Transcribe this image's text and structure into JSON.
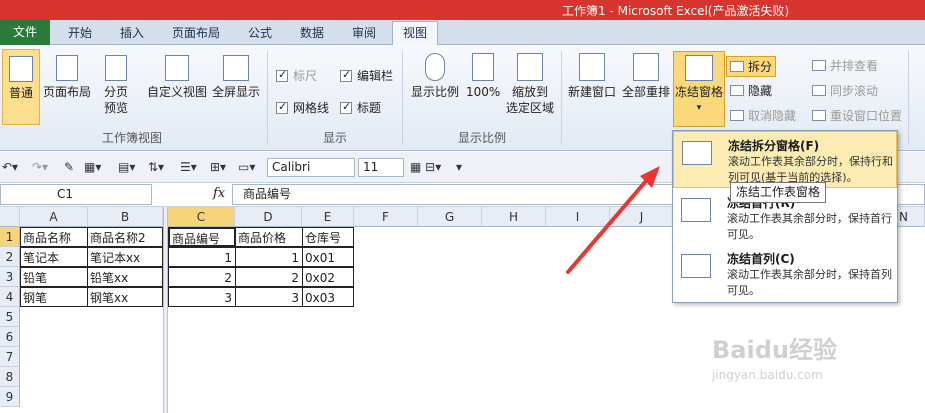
{
  "window": {
    "title": "工作簿1 - Microsoft Excel(产品激活失败)"
  },
  "tabs": [
    "文件",
    "开始",
    "插入",
    "页面布局",
    "公式",
    "数据",
    "审阅",
    "视图"
  ],
  "ribbon": {
    "workbook_views": {
      "label": "工作簿视图",
      "buttons": [
        "普通",
        "页面布局",
        "分页",
        "预览",
        "自定义视图",
        "全屏显示"
      ]
    },
    "show": {
      "label": "显示",
      "checks": [
        {
          "label": "标尺",
          "checked": true,
          "disabled": true
        },
        {
          "label": "编辑栏",
          "checked": true
        },
        {
          "label": "网格线",
          "checked": true
        },
        {
          "label": "标题",
          "checked": true
        }
      ]
    },
    "zoom": {
      "label": "显示比例",
      "buttons": [
        "显示比例",
        "100%",
        "缩放到",
        "选定区域"
      ]
    },
    "window": {
      "buttons": [
        "新建窗口",
        "全部重排",
        "冻结窗格"
      ],
      "small": [
        "拆分",
        "隐藏",
        "取消隐藏",
        "并排查看",
        "同步滚动",
        "重设窗口位置"
      ]
    }
  },
  "toolbar": {
    "font": "Calibri",
    "size": "11"
  },
  "formula_bar": {
    "name_box": "C1",
    "fx": "fx",
    "content": "商品编号"
  },
  "grid": {
    "columns": [
      "A",
      "B",
      "C",
      "D",
      "E",
      "F",
      "G",
      "H",
      "I",
      "J"
    ],
    "rows": [
      "1",
      "2",
      "3",
      "4",
      "5",
      "6",
      "7",
      "8",
      "9"
    ],
    "data": [
      [
        "商品名称",
        "商品名称2",
        "商品编号",
        "商品价格",
        "仓库号"
      ],
      [
        "笔记本",
        "笔记本xx",
        "1",
        "1",
        "0x01"
      ],
      [
        "铅笔",
        "铅笔xx",
        "2",
        "2",
        "0x02"
      ],
      [
        "钢笔",
        "钢笔xx",
        "3",
        "3",
        "0x03"
      ]
    ],
    "extra_cols": [
      "N"
    ]
  },
  "dropdown": {
    "items": [
      {
        "title": "冻结拆分窗格(F)",
        "desc": "滚动工作表其余部分时，保持行和列可见(基于当前的选择)。"
      },
      {
        "title": "冻结首行(R)",
        "desc": "滚动工作表其余部分时，保持首行可见。"
      },
      {
        "title": "冻结首列(C)",
        "desc": "滚动工作表其余部分时，保持首列可见。"
      }
    ],
    "tooltip": "冻结工作表窗格"
  },
  "watermark": {
    "main": "Baidu经验",
    "sub": "jingyan.baidu.com"
  }
}
